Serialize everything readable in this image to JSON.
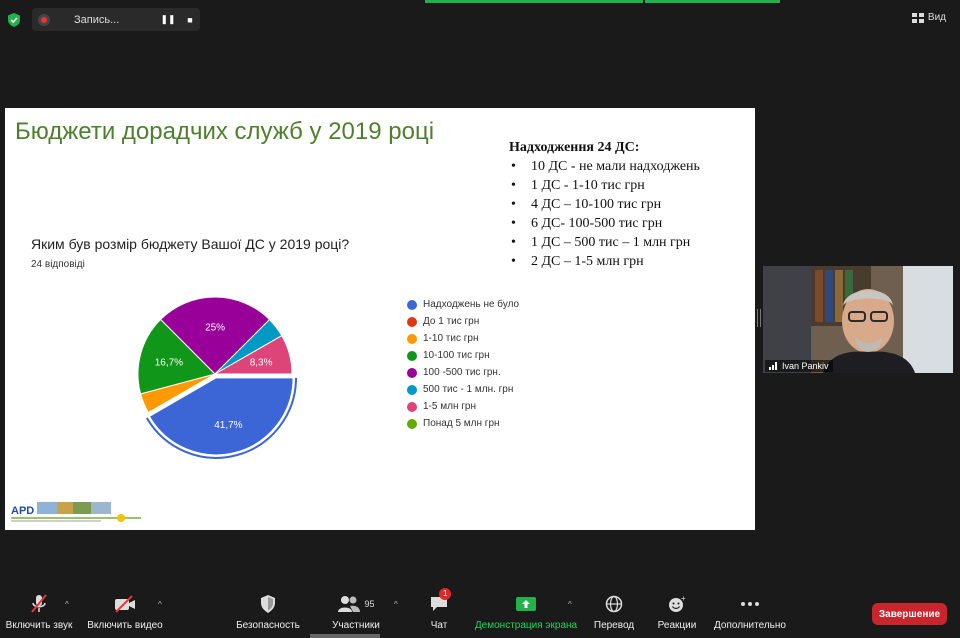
{
  "topbar": {
    "recording_label": "Запись...",
    "view_label": "Вид"
  },
  "slide": {
    "title": "Бюджети дорадчих служб у 2019 році",
    "income": {
      "title": "Надходження 24 ДС:",
      "items": [
        "10 ДС - не мали надходжень",
        "1 ДС - 1-10 тис грн",
        "4 ДС – 10-100 тис грн",
        "6 ДС- 100-500 тис грн",
        "1 ДС – 500 тис – 1 млн грн",
        "2 ДС – 1-5 млн грн"
      ]
    },
    "question": "Яким був розмір бюджету Вашої ДС у 2019 році?",
    "responses": "24 відповіді"
  },
  "chart_data": {
    "type": "pie",
    "slices": [
      {
        "label": "Надходжень не було",
        "value": 41.7,
        "color": "#3c66d6",
        "data_label": "41,7%"
      },
      {
        "label": "До 1 тис грн",
        "value": 0,
        "color": "#dc3912",
        "data_label": ""
      },
      {
        "label": "1-10 тис грн",
        "value": 4.2,
        "color": "#ff9900",
        "data_label": ""
      },
      {
        "label": "10-100 тис грн",
        "value": 16.7,
        "color": "#109618",
        "data_label": "16,7%"
      },
      {
        "label": "100 -500 тис грн.",
        "value": 25,
        "color": "#990099",
        "data_label": "25%"
      },
      {
        "label": "500 тис - 1 млн. грн",
        "value": 4.2,
        "color": "#0099c6",
        "data_label": ""
      },
      {
        "label": "1-5 млн грн",
        "value": 8.3,
        "color": "#dd4477",
        "data_label": "8,3%"
      },
      {
        "label": "Понад 5 млн грн",
        "value": 0,
        "color": "#66aa00",
        "data_label": ""
      }
    ]
  },
  "video": {
    "participant_name": "Ivan Pankiv"
  },
  "toolbar": {
    "mute_label": "Включить звук",
    "video_label": "Включить видео",
    "security_label": "Безопасность",
    "participants_label": "Участники",
    "participants_count": "95",
    "chat_label": "Чат",
    "chat_badge": "1",
    "share_label": "Демонстрация экрана",
    "translate_label": "Перевод",
    "reactions_label": "Реакции",
    "more_label": "Дополнительно",
    "end_label": "Завершение"
  },
  "colors": {
    "accent_green": "#22b14c",
    "end_red": "#c8262c",
    "title_green": "#4f7f2e"
  }
}
